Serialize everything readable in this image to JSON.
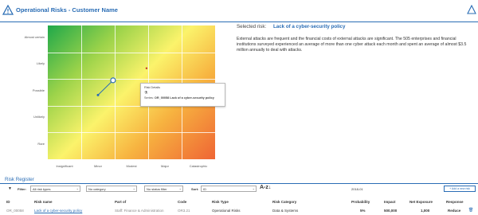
{
  "header": {
    "title": "Operational Risks - Customer Name"
  },
  "colors": {
    "accent": "#2a6db5",
    "green": "#1fa84a",
    "yellow": "#fbf36b",
    "red": "#ef6534"
  },
  "chart_data": {
    "type": "heatmap",
    "xlabel": "",
    "ylabel": "",
    "x_categories": [
      "Insignificant",
      "Minor",
      "Modest",
      "Major",
      "Catastrophic"
    ],
    "y_categories": [
      "Rare",
      "Unlikely",
      "Possible",
      "Likely",
      "Almost certain"
    ],
    "points": [
      {
        "x": 1.5,
        "y": 2.4,
        "label": "selected-risk-start"
      },
      {
        "x": 1.95,
        "y": 2.95,
        "label": "selected-risk-current"
      },
      {
        "x": 2.95,
        "y": 3.4,
        "label": "other-risk"
      }
    ]
  },
  "tooltip": {
    "title": "Risk Details",
    "icon": "risk-icon",
    "series_label": "Series:",
    "series_value": "OR_00058 Lack of a cyber-security policy"
  },
  "selected": {
    "label": "Selected risk:",
    "name": "Lack of a cyber-security policy",
    "description": "External attacks are frequent and the financial costs of external attacks are significant. The 505 enterprises and financial institutions surveyed experienced an average of more than one cyber attack each month and spent an average of almost $3.5 million annually to deal with attacks."
  },
  "register": {
    "title": "Risk Register",
    "toolbar": {
      "filter_label": "Filter:",
      "risk_types": "All risk types",
      "category": "No category",
      "status": "No status filter",
      "sort_label": "Sort:",
      "sort_value": "ID",
      "sort_icon": "A-z↓",
      "date": "2018-01",
      "add_button": "+ Add a new risk"
    },
    "columns": [
      "ID",
      "Risk name",
      "Part of",
      "Code",
      "Risk Type",
      "Risk Category",
      "Probability",
      "Impact",
      "Net Exposure",
      "Response"
    ],
    "rows": [
      {
        "id": "OR_00058",
        "name": "Lack of a cyber-security policy",
        "part_of": "Staff: Finance & Administration",
        "code": "OR3.21",
        "type": "Operational Risks",
        "category": "Data & Systems",
        "probability": "5%",
        "impact": "500,000",
        "net_exposure": "1,000",
        "response": "Reduce"
      }
    ]
  }
}
